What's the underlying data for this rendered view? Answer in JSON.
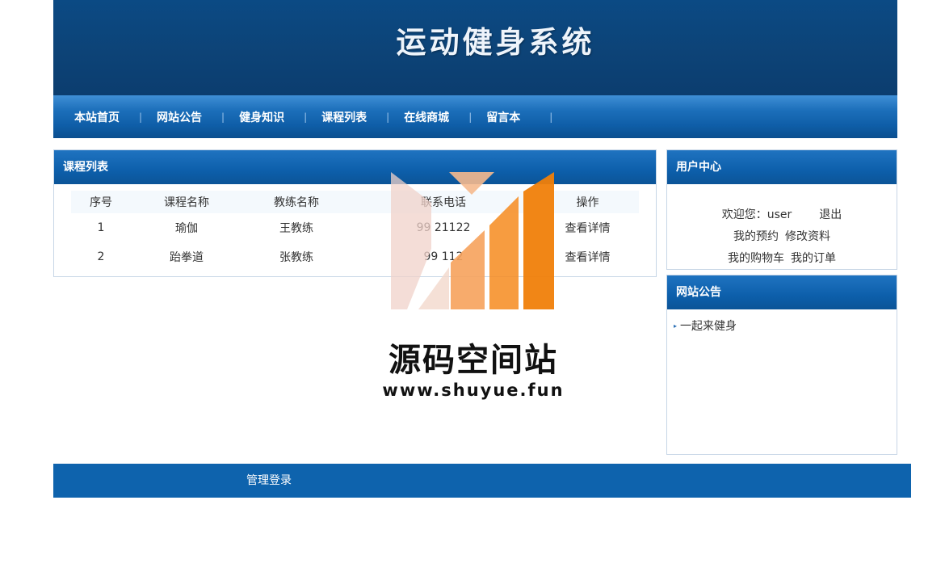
{
  "header": {
    "title": "运动健身系统"
  },
  "nav": {
    "items": [
      "本站首页",
      "网站公告",
      "健身知识",
      "课程列表",
      "在线商城",
      "留言本"
    ]
  },
  "course_panel": {
    "title": "课程列表",
    "columns": [
      "序号",
      "课程名称",
      "教练名称",
      "联系电话",
      "操作"
    ],
    "rows": [
      {
        "index": "1",
        "name": "瑜伽",
        "coach": "王教练",
        "phone": "99  21122",
        "action": "查看详情"
      },
      {
        "index": "2",
        "name": "跆拳道",
        "coach": "张教练",
        "phone": "99  112",
        "action": "查看详情"
      }
    ]
  },
  "user_panel": {
    "title": "用户中心",
    "welcome": "欢迎您：user",
    "logout": "退出",
    "my_booking": "我的预约",
    "edit_profile": "修改资料",
    "my_cart": "我的购物车",
    "my_orders": "我的订单"
  },
  "notice_panel": {
    "title": "网站公告",
    "items": [
      "一起来健身"
    ]
  },
  "watermark": {
    "title": "源码空间站",
    "url": "www.shuyue.fun"
  },
  "footer": {
    "admin_login": "管理登录"
  },
  "colors": {
    "banner": "#0d4377",
    "nav": "#1c6fba",
    "panel_header": "#0d5fab",
    "footer": "#0e63ad"
  }
}
